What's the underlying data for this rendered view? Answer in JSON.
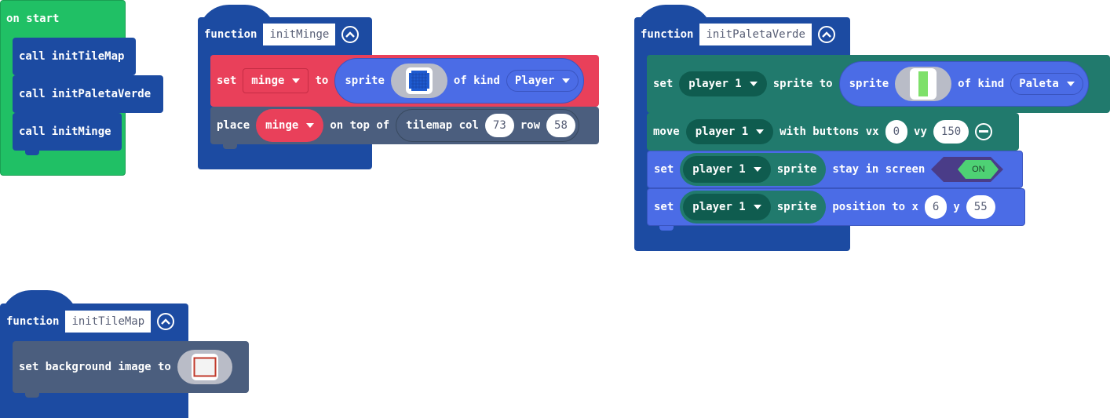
{
  "colors": {
    "function_blue": "#1c4ba2",
    "on_start_green": "#20c065",
    "sprite_red": "#e9405a",
    "sprite_light_blue": "#4b6ce6",
    "scene_slate": "#4b5e7e",
    "controller_teal": "#217a6d",
    "variable_dark_teal": "#0f5c4f",
    "toggle_purple": "#4a3c88",
    "toggle_green": "#4ed174"
  },
  "on_start": {
    "label": "on start",
    "calls": [
      {
        "kw": "call",
        "name": "initTileMap"
      },
      {
        "kw": "call",
        "name": "initPaletaVerde"
      },
      {
        "kw": "call",
        "name": "initMinge"
      }
    ]
  },
  "init_minge": {
    "kw": "function",
    "name": "initMinge",
    "set_block": {
      "set": "set",
      "var": "minge",
      "to": "to",
      "sprite": "sprite",
      "of_kind": "of kind",
      "kind": "Player",
      "image": "ball-sprite-icon"
    },
    "place_block": {
      "place": "place",
      "var": "minge",
      "on_top_of": "on top of",
      "tilemap_col": "tilemap col",
      "col": "73",
      "row_label": "row",
      "row": "58"
    }
  },
  "init_paleta": {
    "kw": "function",
    "name": "initPaletaVerde",
    "set_block": {
      "set": "set",
      "var": "player 1",
      "sprite_to": "sprite to",
      "sprite": "sprite",
      "of_kind": "of kind",
      "kind": "Paleta",
      "image": "paddle-sprite-icon"
    },
    "move_block": {
      "move": "move",
      "var": "player 1",
      "with_buttons_vx": "with buttons vx",
      "vx": "0",
      "vy_label": "vy",
      "vy": "150"
    },
    "stay_block": {
      "set": "set",
      "var": "player 1",
      "sprite": "sprite",
      "stay_in_screen": "stay in screen",
      "toggle": "ON"
    },
    "position_block": {
      "set": "set",
      "var": "player 1",
      "sprite": "sprite",
      "position_to_x": "position to x",
      "x": "6",
      "y_label": "y",
      "y": "55"
    }
  },
  "init_tilemap": {
    "kw": "function",
    "name": "initTileMap",
    "bg_block": {
      "text": "set background image to",
      "image": "background-image-icon"
    }
  }
}
